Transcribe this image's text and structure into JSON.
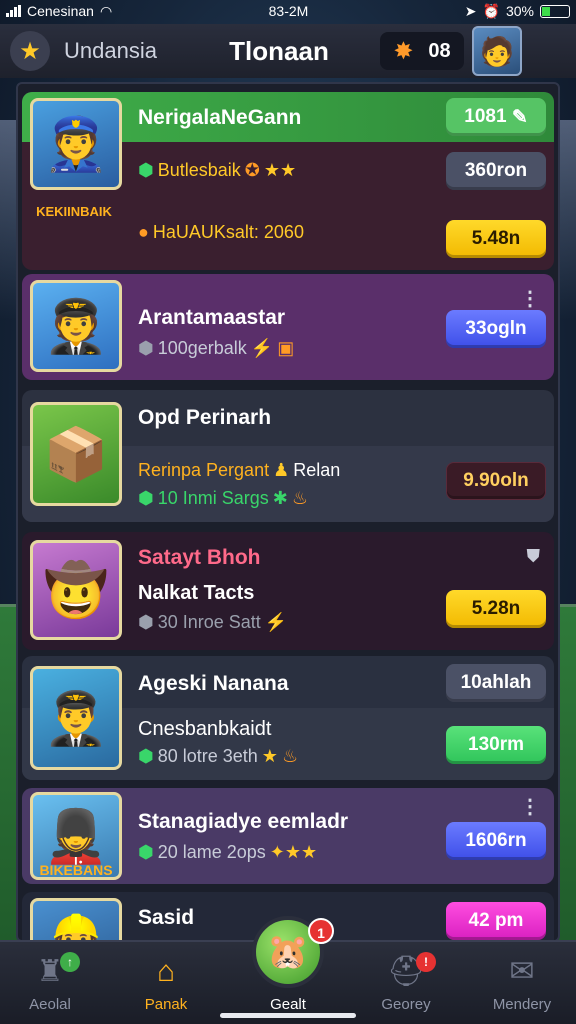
{
  "status_bar": {
    "carrier": "Cenesinan",
    "time": "83-2M",
    "battery": "30%"
  },
  "header": {
    "subtitle": "Undansia",
    "title": "Tlonaan",
    "coins": "08",
    "star_icon": "star-icon",
    "coin_icon": "star-coin-icon"
  },
  "cards": [
    {
      "name": "NerigalaNeGann",
      "top_value": "1081",
      "sub_text": "Butlesbaik",
      "price": "360ron",
      "extra_text": "HaUAUKsalt: 2060",
      "extra_price": "5.48n",
      "badge_text": "KEKIINBAIK",
      "accent": "#3fae49",
      "bg": "#3a1f2f"
    },
    {
      "name": "Arantamaastar",
      "sub_text": "100gerbalk",
      "price": "33ogln",
      "bg": "#5a2f6a"
    },
    {
      "name": "Opd Perinarh",
      "sub_line_1": "Rerinpa Pergant",
      "sub_line_1_tag": "Relan",
      "sub_text": "10 Inmi Sargs",
      "price": "9.90oln",
      "bg": "#2c3140"
    },
    {
      "name": "Satayt Bhoh",
      "sub_line_1": "Nalkat Tacts",
      "sub_text": "30 Inroe Satt",
      "price": "5.28n",
      "bg": "#2a1a2c"
    },
    {
      "name": "Ageski Nanana",
      "top_value": "10ahlah",
      "sub_line_1": "Cnesbanbkaidt",
      "sub_text": "80 lotre 3eth",
      "price": "130rm",
      "bg": "#2a3040"
    },
    {
      "name": "Stanagiadye eemladr",
      "sub_text": "20 lame 2ops",
      "price": "1606rn",
      "badge_text": "BIKEBANS",
      "bg": "#4a3a66"
    },
    {
      "name": "Sasid",
      "price": "42 pm",
      "bg": "#232838"
    }
  ],
  "nav": [
    {
      "label": "Aeolal",
      "icon": "castle-icon",
      "badge": ""
    },
    {
      "label": "Panak",
      "icon": "home-icon",
      "badge": ""
    },
    {
      "label": "Gealt",
      "icon": "character-icon",
      "badge": "1"
    },
    {
      "label": "Georey",
      "icon": "helmet-icon",
      "badge": ""
    },
    {
      "label": "Mendery",
      "icon": "chat-icon",
      "badge": ""
    }
  ],
  "colors": {
    "accent_yellow": "#ffc928",
    "accent_green": "#3fae49",
    "accent_blue": "#3d4ee8",
    "accent_magenta": "#d81fc0"
  }
}
